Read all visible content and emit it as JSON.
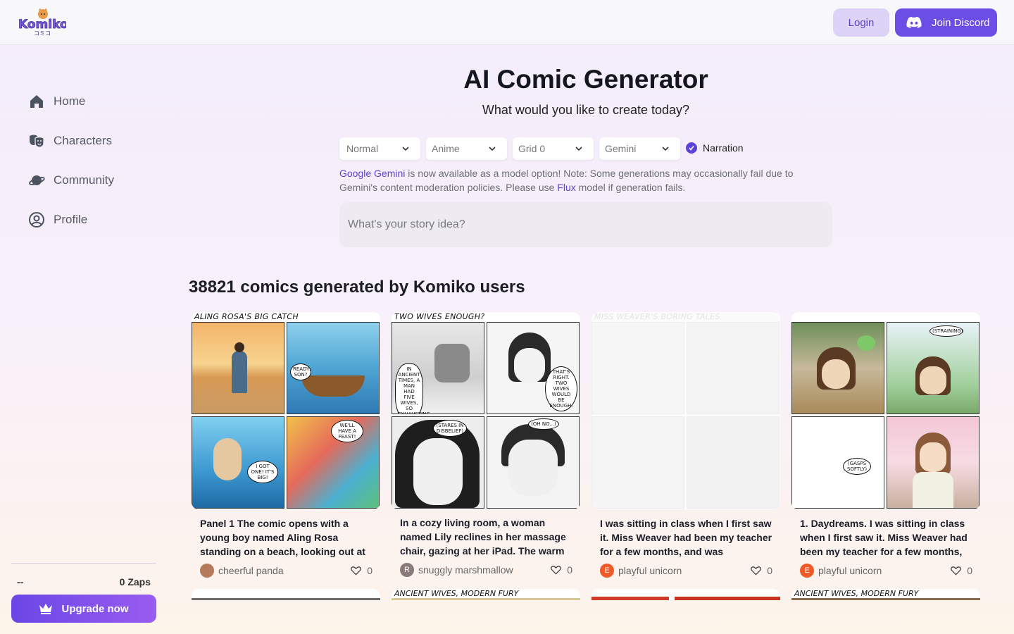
{
  "header": {
    "logo_text": "Komiko",
    "logo_sub": "コミコ",
    "login_label": "Login",
    "discord_label": "Join Discord"
  },
  "sidebar": {
    "items": [
      {
        "label": "Home",
        "icon": "home-icon"
      },
      {
        "label": "Characters",
        "icon": "theater-masks-icon"
      },
      {
        "label": "Community",
        "icon": "planet-icon"
      },
      {
        "label": "Profile",
        "icon": "user-circle-icon"
      }
    ],
    "user_name": "--",
    "zaps": "0 Zaps",
    "upgrade_label": "Upgrade now"
  },
  "hero": {
    "title": "AI Comic Generator",
    "subtitle": "What would you like to create today?",
    "selects": {
      "mode": "Normal",
      "style": "Anime",
      "grid": "Grid 0",
      "model": "Gemini"
    },
    "narration_label": "Narration",
    "notice_link1": "Google Gemini",
    "notice_text1": " is now available as a model option! Note: Some generations may occasionally fail due to Gemini's content moderation policies. Please use ",
    "notice_link2": "Flux",
    "notice_text2": " model if generation fails.",
    "story_placeholder": "What's your story idea?"
  },
  "gallery": {
    "count_title": "38821 comics generated by Komiko users",
    "cards": [
      {
        "comic_title": "ALING ROSA'S BIG CATCH",
        "bubbles": [
          "READY, SON?",
          "I GOT ONE! IT'S BIG!",
          "WE'LL HAVE A FEAST!"
        ],
        "description": "Panel 1 The comic opens with a young boy named Aling Rosa standing on a beach, looking out at",
        "user": "cheerful panda",
        "avatar_letter": "",
        "likes": "0"
      },
      {
        "comic_title": "TWO WIVES ENOUGH?",
        "bubbles": [
          "IN ANCIENT TIMES, A MAN HAD FIVE WIVES, SO EXHAUSTING.",
          "THAT'S RIGHT. TWO WIVES WOULD BE ENOUGH.",
          "(STARES IN DISBELIEF)",
          "(OH NO...)"
        ],
        "description": "In a cozy living room, a woman named Lily reclines in her massage chair, gazing at her iPad. The warm",
        "user": "snuggly marshmallow",
        "avatar_letter": "R",
        "likes": "0"
      },
      {
        "comic_title": "MISS WEAVER'S BORING TALES",
        "bubbles": [],
        "description": "I was sitting in class when I first saw it. Miss Weaver had been my teacher for a few months, and was",
        "user": "playful unicorn",
        "avatar_letter": "E",
        "likes": "0"
      },
      {
        "comic_title": "",
        "bubbles": [
          "(STRAINING)",
          "(GASPS SOFTLY)"
        ],
        "description": "1. Daydreams. I was sitting in class when I first saw it. Miss Weaver had been my teacher for a few months,",
        "user": "playful unicorn",
        "avatar_letter": "E",
        "likes": "0"
      }
    ],
    "row2_titles": [
      "",
      "ANCIENT WIVES, MODERN FURY",
      "",
      "ANCIENT WIVES, MODERN FURY"
    ]
  }
}
